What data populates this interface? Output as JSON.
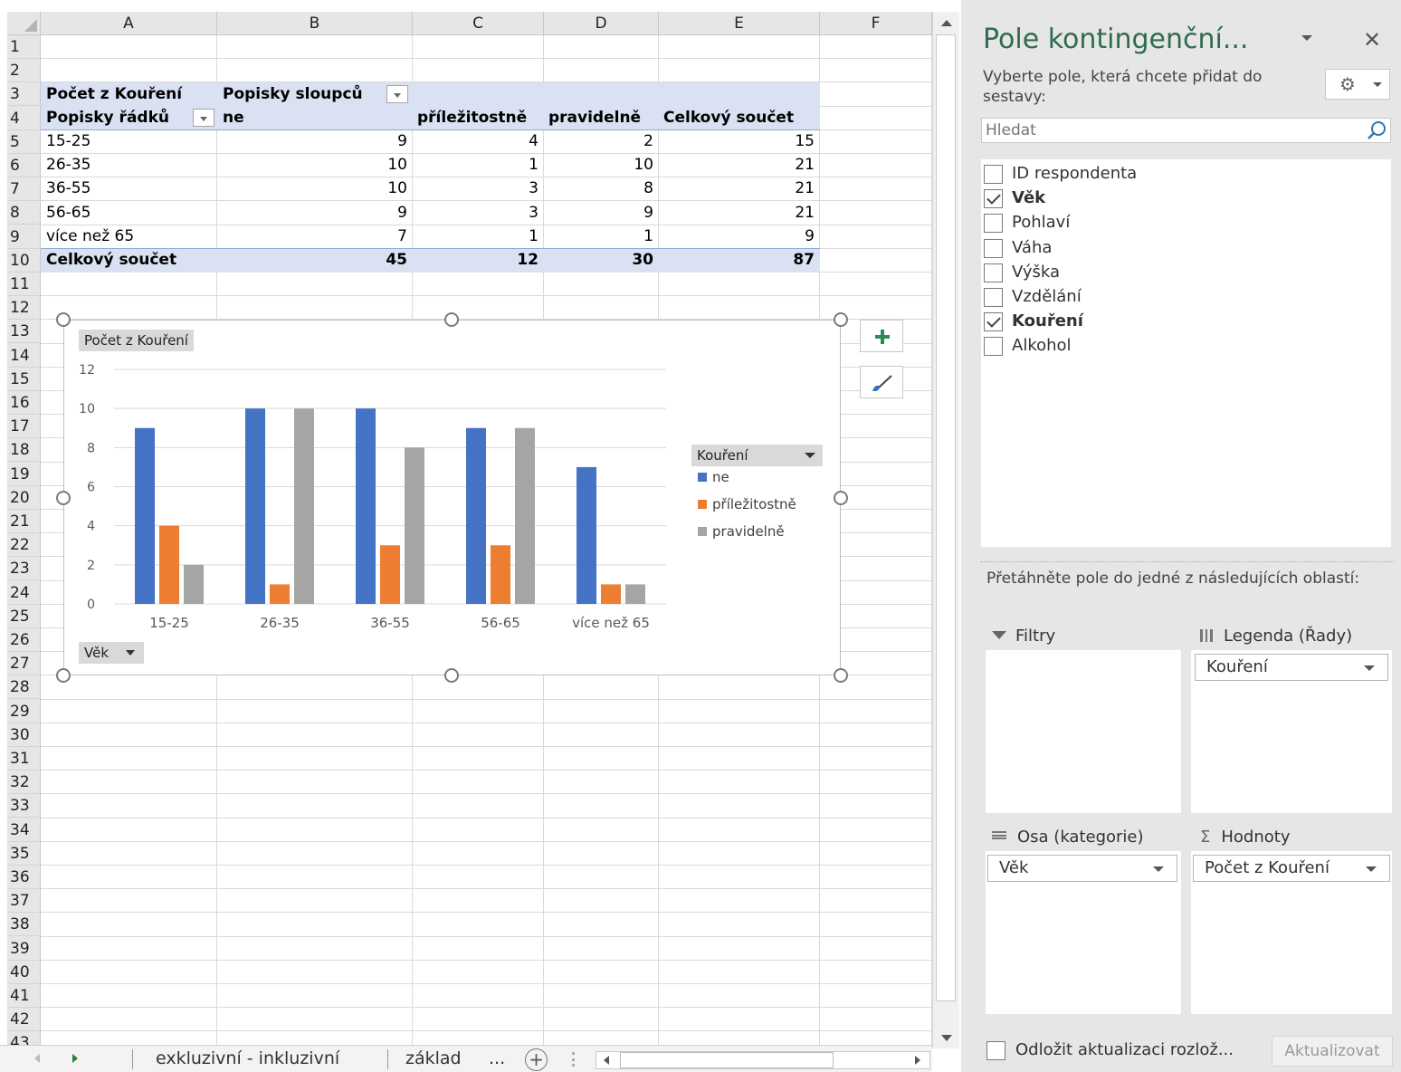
{
  "sheet": {
    "columns": [
      "A",
      "B",
      "C",
      "D",
      "E",
      "F"
    ],
    "rows": [
      "1",
      "2",
      "3",
      "4",
      "5",
      "6",
      "7",
      "8",
      "9",
      "10",
      "11",
      "12",
      "13",
      "14",
      "15",
      "16",
      "17",
      "18",
      "19",
      "20",
      "21",
      "22",
      "23",
      "24",
      "25",
      "26",
      "27",
      "28",
      "29",
      "30",
      "31",
      "32",
      "33",
      "34",
      "35",
      "36",
      "37",
      "38",
      "39",
      "40",
      "41",
      "42",
      "43"
    ],
    "tabs": {
      "sheet1": "exkluzivní - inkluzivní",
      "sheet2": "základ",
      "more": "..."
    }
  },
  "pivot": {
    "value_label": "Počet z Kouření",
    "column_labels_header": "Popisky sloupců",
    "row_labels_header": "Popisky řádků",
    "columns": [
      "ne",
      "příležitostně",
      "pravidelně",
      "Celkový součet"
    ],
    "rows": [
      {
        "label": "15-25",
        "values": [
          "9",
          "4",
          "2",
          "15"
        ]
      },
      {
        "label": "26-35",
        "values": [
          "10",
          "1",
          "10",
          "21"
        ]
      },
      {
        "label": "36-55",
        "values": [
          "10",
          "3",
          "8",
          "21"
        ]
      },
      {
        "label": "56-65",
        "values": [
          "9",
          "3",
          "9",
          "21"
        ]
      },
      {
        "label": "více než 65",
        "values": [
          "7",
          "1",
          "1",
          "9"
        ]
      }
    ],
    "total": {
      "label": "Celkový součet",
      "values": [
        "45",
        "12",
        "30",
        "87"
      ]
    }
  },
  "chart_buttons": {
    "value_field": "Počet z Kouření",
    "axis_field": "Věk",
    "legend_field": "Kouření"
  },
  "chart_data": {
    "type": "bar",
    "categories": [
      "15-25",
      "26-35",
      "36-55",
      "56-65",
      "více než 65"
    ],
    "series": [
      {
        "name": "ne",
        "color": "#4472c4",
        "values": [
          9,
          10,
          10,
          9,
          7
        ]
      },
      {
        "name": "příležitostně",
        "color": "#ed7d31",
        "values": [
          4,
          1,
          3,
          3,
          1
        ]
      },
      {
        "name": "pravidelně",
        "color": "#a5a5a5",
        "values": [
          2,
          10,
          8,
          9,
          1
        ]
      }
    ],
    "ylim": [
      0,
      12
    ],
    "yticks": [
      0,
      2,
      4,
      6,
      8,
      10,
      12
    ],
    "grid": true,
    "legend": "right"
  },
  "pane": {
    "title": "Pole kontingenční...",
    "instruction": "Vyberte pole, která chcete přidat do sestavy:",
    "search_placeholder": "Hledat",
    "fields": [
      {
        "label": "ID respondenta",
        "checked": false
      },
      {
        "label": "Věk",
        "checked": true
      },
      {
        "label": "Pohlaví",
        "checked": false
      },
      {
        "label": "Váha",
        "checked": false
      },
      {
        "label": "Výška",
        "checked": false
      },
      {
        "label": "Vzdělání",
        "checked": false
      },
      {
        "label": "Kouření",
        "checked": true
      },
      {
        "label": "Alkohol",
        "checked": false
      }
    ],
    "drag_instruction": "Přetáhněte pole do jedné z následujících oblastí:",
    "areas": {
      "filters": {
        "title": "Filtry"
      },
      "legend": {
        "title": "Legenda (Řady)",
        "item": "Kouření"
      },
      "axis": {
        "title": "Osa (kategorie)",
        "item": "Věk"
      },
      "values": {
        "title": "Hodnoty",
        "item": "Počet z Kouření"
      }
    },
    "defer_label": "Odložit aktualizaci rozlož...",
    "update_button": "Aktualizovat"
  },
  "colors": {
    "pivot_band": "#d9e1f2",
    "pane_title": "#2f6c4f"
  }
}
